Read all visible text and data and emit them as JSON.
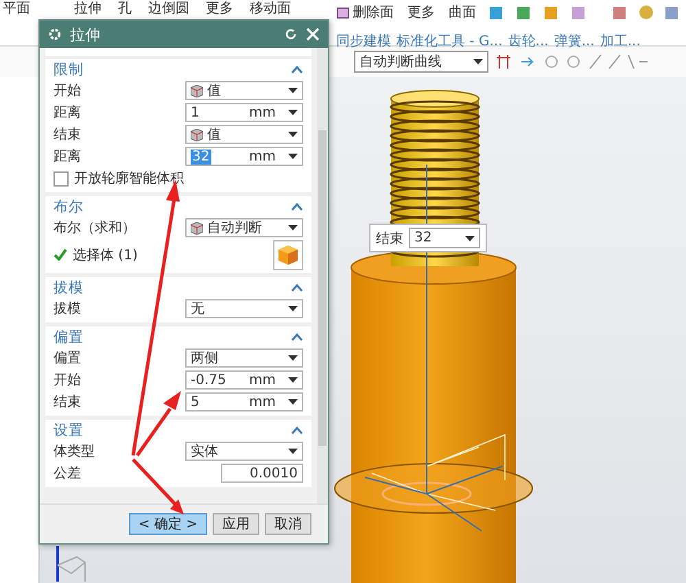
{
  "ribbon": {
    "top_labels": [
      "平面",
      "拉伸",
      "孔",
      "边倒圆",
      "更多",
      "移动面"
    ],
    "commands": [
      "删除面",
      "更多",
      "曲面"
    ],
    "groups": [
      "同步建模",
      "标准化工具 - G...",
      "齿轮...",
      "弹簧...",
      "加工..."
    ]
  },
  "toolbar": {
    "curve_rule": "自动判断曲线"
  },
  "dialog": {
    "title": "拉伸",
    "sections": [
      {
        "title": "限制",
        "expanded": true,
        "rows": [
          {
            "kind": "icon_select",
            "label": "开始",
            "value": "值"
          },
          {
            "kind": "number",
            "label": "距离",
            "value": "1",
            "unit": "mm",
            "highlighted": false
          },
          {
            "kind": "icon_select",
            "label": "结束",
            "value": "值"
          },
          {
            "kind": "number",
            "label": "距离",
            "value": "32",
            "unit": "mm",
            "highlighted": true
          },
          {
            "kind": "checkbox",
            "label": "开放轮廓智能体积",
            "checked": false
          }
        ]
      },
      {
        "title": "布尔",
        "expanded": true,
        "rows": [
          {
            "kind": "icon_select",
            "label": "布尔（求和）",
            "value": "自动判断"
          },
          {
            "kind": "body_select",
            "label": "选择体 (1)",
            "done": true
          }
        ]
      },
      {
        "title": "拔模",
        "expanded": true,
        "rows": [
          {
            "kind": "select",
            "label": "拔模",
            "value": "无"
          }
        ]
      },
      {
        "title": "偏置",
        "expanded": true,
        "rows": [
          {
            "kind": "select",
            "label": "偏置",
            "value": "两侧"
          },
          {
            "kind": "number",
            "label": "开始",
            "value": "-0.75",
            "unit": "mm",
            "highlighted": false
          },
          {
            "kind": "number",
            "label": "结束",
            "value": "5",
            "unit": "mm",
            "highlighted": false
          }
        ]
      },
      {
        "title": "设置",
        "expanded": true,
        "rows": [
          {
            "kind": "select",
            "label": "体类型",
            "value": "实体"
          },
          {
            "kind": "tolerance",
            "label": "公差",
            "value": "0.0010"
          }
        ]
      }
    ],
    "buttons": [
      {
        "label": "< 确定 >",
        "default": true
      },
      {
        "label": "应用",
        "default": false
      },
      {
        "label": "取消",
        "default": false
      }
    ]
  },
  "floating_field": {
    "label": "结束",
    "value": "32"
  }
}
